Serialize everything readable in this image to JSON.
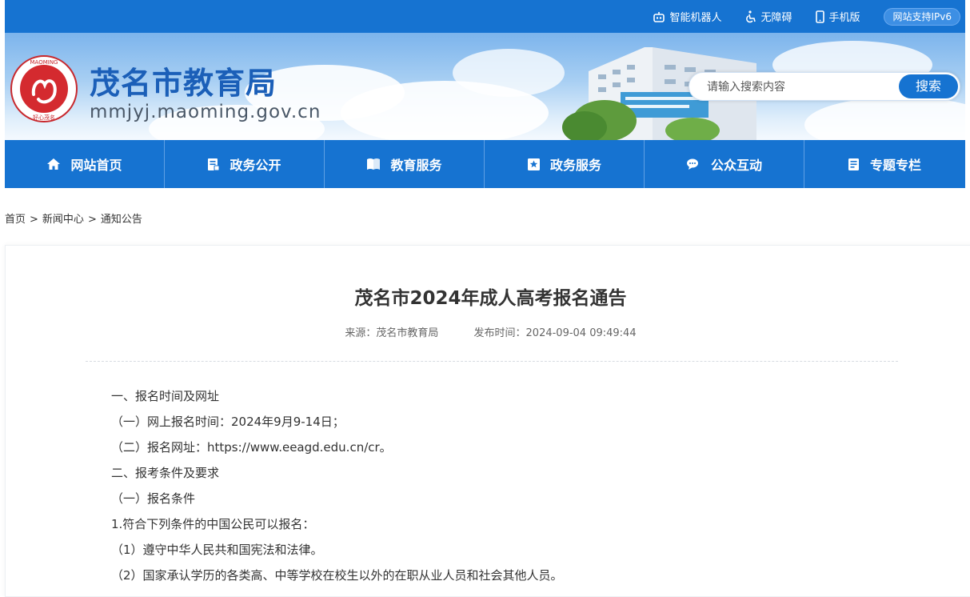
{
  "topbar": {
    "robot": "智能机器人",
    "accessible": "无障碍",
    "mobile": "手机版",
    "ipv6": "网站支持IPv6"
  },
  "header": {
    "title": "茂名市教育局",
    "domain": "mmjyj.maoming.gov.cn",
    "logo_ring_text": "MAOMING",
    "logo_sub": "好心茂名"
  },
  "search": {
    "placeholder": "请输入搜索内容",
    "button": "搜索"
  },
  "nav": [
    {
      "label": "网站首页",
      "icon": "home-icon"
    },
    {
      "label": "政务公开",
      "icon": "document-icon"
    },
    {
      "label": "教育服务",
      "icon": "book-icon"
    },
    {
      "label": "政务服务",
      "icon": "star-icon"
    },
    {
      "label": "公众互动",
      "icon": "chat-icon"
    },
    {
      "label": "专题专栏",
      "icon": "list-icon"
    }
  ],
  "breadcrumb": [
    "首页",
    "新闻中心",
    "通知公告"
  ],
  "article": {
    "title": "茂名市2024年成人高考报名通告",
    "source": "来源：茂名市教育局",
    "date": "发布时间：2024-09-04 09:49:44",
    "paragraphs": [
      "一、报名时间及网址",
      "（一）网上报名时间：2024年9月9-14日；",
      "（二）报名网址：https://www.eeagd.edu.cn/cr。",
      "二、报考条件及要求",
      "（一）报名条件",
      "1.符合下列条件的中国公民可以报名：",
      "（1）遵守中华人民共和国宪法和法律。",
      "（2）国家承认学历的各类高、中等学校在校生以外的在职从业人员和社会其他人员。"
    ]
  },
  "colors": {
    "primary": "#1673d1",
    "title_blue": "#1b5fb8"
  }
}
